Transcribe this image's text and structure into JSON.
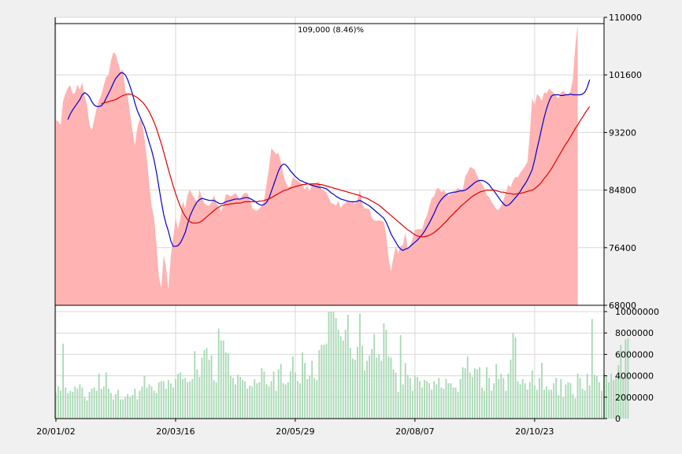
{
  "chart_data": [
    {
      "type": "area",
      "title": "",
      "annotation": "109,000 (8.46)%",
      "annotation_color": "#e00000",
      "ylim": [
        68000,
        110000
      ],
      "y_ticks": [
        68000,
        76400,
        84800,
        93200,
        101600,
        110000
      ],
      "y_tick_labels": [
        "68000",
        "76400",
        "84800",
        "93200",
        "101600",
        "110000"
      ],
      "y_axis_side": "right",
      "grid": true,
      "x_tick_labels": [
        "20/01/02",
        "20/03/16",
        "20/05/29",
        "20/08/07",
        "20/10/23"
      ],
      "x_tick_index": [
        0,
        50,
        100,
        150,
        200
      ],
      "n_days": 230,
      "colors": {
        "price_area": "#ffb3b3",
        "ma_short": "#0000d0",
        "ma_long": "#e00000",
        "volume": "#a8d8b4"
      },
      "series": [
        {
          "role": "price",
          "values": [
            95000,
            94800,
            94300,
            97800,
            98900,
            99700,
            100100,
            98800,
            99000,
            100200,
            99400,
            100500,
            98600,
            97200,
            94300,
            93500,
            95100,
            96700,
            97900,
            98700,
            100100,
            101300,
            101600,
            103700,
            104900,
            104600,
            103300,
            102100,
            102400,
            99300,
            98500,
            96000,
            93400,
            91300,
            93900,
            95200,
            94600,
            92300,
            89400,
            85700,
            82400,
            80800,
            76900,
            72200,
            70600,
            75300,
            73600,
            70300,
            75200,
            77800,
            80800,
            79100,
            80700,
            83200,
            82100,
            84100,
            84900,
            84100,
            83600,
            82800,
            84900,
            83700,
            82900,
            82600,
            82500,
            83000,
            84100,
            83000,
            82300,
            81700,
            82500,
            84200,
            84100,
            83900,
            84100,
            84400,
            83900,
            83400,
            84100,
            84400,
            84300,
            83500,
            82200,
            81900,
            81800,
            82100,
            82500,
            83300,
            85700,
            88000,
            90900,
            90500,
            90000,
            90200,
            88900,
            87100,
            85900,
            85300,
            85300,
            86700,
            86300,
            86200,
            85900,
            85600,
            84900,
            85400,
            84600,
            85600,
            85700,
            85900,
            86000,
            84900,
            84700,
            84500,
            83700,
            82900,
            82800,
            82500,
            83200,
            82200,
            82700,
            82900,
            83300,
            82900,
            83100,
            82800,
            83400,
            84900,
            82800,
            82100,
            82100,
            82000,
            80700,
            80400,
            80300,
            80400,
            80300,
            80200,
            78200,
            74800,
            73000,
            75000,
            76600,
            75600,
            76600,
            76800,
            78600,
            76200,
            76800,
            77700,
            79000,
            79100,
            79100,
            79100,
            80300,
            81100,
            82400,
            83600,
            83900,
            85000,
            85100,
            84500,
            84800,
            84400,
            84000,
            84300,
            84400,
            84800,
            85100,
            84900,
            84900,
            86800,
            87300,
            88200,
            88000,
            87800,
            86900,
            86200,
            85700,
            85100,
            84100,
            83800,
            83100,
            82600,
            82000,
            81900,
            82500,
            83400,
            84400,
            85600,
            85200,
            86200,
            86700,
            86700,
            87300,
            87800,
            88300,
            88900,
            93000,
            98200,
            97200,
            98800,
            98500,
            97800,
            99100,
            98900,
            99600,
            99300,
            99000,
            98500,
            98200,
            99000,
            99300,
            98900,
            98700,
            99200,
            101100,
            105800,
            109000
          ]
        },
        {
          "role": "ma_short",
          "values": [
            null,
            null,
            null,
            null,
            null,
            95100,
            95900,
            96500,
            97000,
            97500,
            98000,
            98700,
            99000,
            98800,
            98400,
            97700,
            97200,
            97000,
            97000,
            97100,
            97500,
            98200,
            98900,
            99600,
            100400,
            101100,
            101500,
            101900,
            101900,
            101600,
            100900,
            99900,
            98800,
            97500,
            96400,
            95600,
            94800,
            94000,
            92900,
            91700,
            90600,
            89200,
            87400,
            85300,
            83200,
            81300,
            79900,
            78800,
            77400,
            76600,
            76600,
            76700,
            77100,
            77800,
            78600,
            79800,
            81000,
            81800,
            82500,
            83100,
            83400,
            83600,
            83500,
            83400,
            83300,
            83300,
            83300,
            83100,
            82900,
            82800,
            82900,
            83100,
            83200,
            83300,
            83400,
            83500,
            83500,
            83500,
            83600,
            83700,
            83700,
            83600,
            83400,
            83200,
            82900,
            82700,
            82600,
            82700,
            83000,
            83600,
            84600,
            85600,
            86600,
            87600,
            88300,
            88600,
            88500,
            88100,
            87600,
            87200,
            86800,
            86500,
            86200,
            86100,
            85900,
            85800,
            85600,
            85500,
            85400,
            85300,
            85200,
            85200,
            85100,
            85000,
            84700,
            84400,
            84200,
            83900,
            83700,
            83500,
            83400,
            83300,
            83200,
            83100,
            83100,
            83100,
            83200,
            83300,
            83100,
            82900,
            82700,
            82500,
            82200,
            81900,
            81600,
            81300,
            81000,
            80700,
            80100,
            79300,
            78400,
            77800,
            77200,
            76600,
            76200,
            76000,
            76200,
            76300,
            76600,
            76900,
            77200,
            77500,
            77900,
            78300,
            78800,
            79400,
            80000,
            80700,
            81400,
            82200,
            82900,
            83400,
            83800,
            84100,
            84300,
            84400,
            84500,
            84500,
            84600,
            84700,
            84700,
            84800,
            85000,
            85300,
            85600,
            85900,
            86100,
            86200,
            86200,
            86100,
            85900,
            85600,
            85100,
            84700,
            84200,
            83700,
            83200,
            82800,
            82500,
            82600,
            82900,
            83300,
            83700,
            84100,
            84600,
            85200,
            85700,
            86300,
            87000,
            87800,
            89200,
            90800,
            92300,
            93900,
            95400,
            96700,
            97700,
            98500,
            98700,
            98700,
            98700,
            98600,
            98600,
            98700,
            98700,
            98800,
            98700,
            98700,
            98700,
            98700,
            98800,
            99100,
            99800,
            100900
          ]
        },
        {
          "role": "ma_long",
          "values": [
            null,
            null,
            null,
            null,
            null,
            null,
            null,
            null,
            null,
            null,
            null,
            null,
            null,
            null,
            null,
            null,
            null,
            null,
            null,
            97400,
            97500,
            97600,
            97700,
            97800,
            97900,
            98000,
            98200,
            98400,
            98600,
            98700,
            98800,
            98800,
            98700,
            98500,
            98300,
            98000,
            97700,
            97300,
            96800,
            96200,
            95500,
            94700,
            93800,
            92700,
            91600,
            90400,
            89100,
            87800,
            86600,
            85400,
            84300,
            83300,
            82400,
            81600,
            81000,
            80500,
            80200,
            80000,
            80000,
            80000,
            80100,
            80300,
            80600,
            80900,
            81200,
            81500,
            81800,
            82100,
            82300,
            82500,
            82600,
            82700,
            82700,
            82800,
            82800,
            82900,
            82900,
            82900,
            83000,
            83100,
            83100,
            83100,
            83100,
            83100,
            83100,
            83200,
            83200,
            83300,
            83400,
            83500,
            83700,
            83900,
            84100,
            84300,
            84500,
            84700,
            84800,
            84900,
            85100,
            85200,
            85300,
            85400,
            85500,
            85600,
            85600,
            85700,
            85700,
            85700,
            85700,
            85700,
            85600,
            85600,
            85500,
            85400,
            85300,
            85200,
            85100,
            85000,
            84900,
            84800,
            84700,
            84600,
            84500,
            84400,
            84300,
            84200,
            84100,
            84000,
            83800,
            83700,
            83600,
            83400,
            83200,
            83000,
            82800,
            82600,
            82300,
            82000,
            81700,
            81400,
            81100,
            80800,
            80500,
            80200,
            79900,
            79600,
            79300,
            79000,
            78800,
            78500,
            78300,
            78100,
            78000,
            78000,
            78000,
            78100,
            78200,
            78400,
            78600,
            78900,
            79200,
            79500,
            79900,
            80200,
            80600,
            81000,
            81300,
            81700,
            82000,
            82400,
            82700,
            83000,
            83300,
            83600,
            83900,
            84100,
            84300,
            84500,
            84600,
            84700,
            84800,
            84800,
            84800,
            84800,
            84700,
            84600,
            84500,
            84500,
            84400,
            84300,
            84300,
            84200,
            84200,
            84300,
            84300,
            84400,
            84500,
            84600,
            84700,
            84800,
            85000,
            85300,
            85600,
            86000,
            86500,
            86900,
            87400,
            87900,
            88500,
            89100,
            89700,
            90300,
            90900,
            91500,
            92000,
            92600,
            93200,
            93800,
            94300,
            94900,
            95400,
            96000,
            96500,
            97000
          ]
        }
      ]
    },
    {
      "type": "bar",
      "title": "",
      "ylim": [
        0,
        10000000
      ],
      "y_ticks": [
        0,
        2000000,
        4000000,
        6000000,
        8000000,
        10000000
      ],
      "y_tick_labels": [
        "0",
        "2000000",
        "4000000",
        "6000000",
        "8000000",
        "10000000"
      ],
      "y_axis_side": "right",
      "grid": true,
      "series": [
        {
          "role": "volume",
          "values": [
            2400000,
            3000000,
            2600000,
            7000000,
            2900000,
            2400000,
            2600000,
            2500000,
            3000000,
            2800000,
            3200000,
            2900000,
            2000000,
            1700000,
            2500000,
            2800000,
            2900000,
            2600000,
            4200000,
            2800000,
            3000000,
            4300000,
            2800000,
            2400000,
            1800000,
            2300000,
            2700000,
            1800000,
            1800000,
            2000000,
            2300000,
            2000000,
            2200000,
            2800000,
            1800000,
            2600000,
            3000000,
            4000000,
            2900000,
            3200000,
            3000000,
            2600000,
            2400000,
            3400000,
            3500000,
            3500000,
            2800000,
            3600000,
            3300000,
            2900000,
            3700000,
            4200000,
            4300000,
            3700000,
            3800000,
            3400000,
            3500000,
            3700000,
            6300000,
            4600000,
            3900000,
            5700000,
            6400000,
            6600000,
            5500000,
            5900000,
            3600000,
            3400000,
            8400000,
            7300000,
            7300000,
            6200000,
            6100000,
            4000000,
            3800000,
            3200000,
            4100000,
            3900000,
            3600000,
            3500000,
            2800000,
            3100000,
            3000000,
            3700000,
            3300000,
            3400000,
            4700000,
            4400000,
            3200000,
            3000000,
            3500000,
            4400000,
            2600000,
            4600000,
            5100000,
            3300000,
            3200000,
            3400000,
            4400000,
            5800000,
            4300000,
            3500000,
            3300000,
            6200000,
            5200000,
            3700000,
            4000000,
            5400000,
            3800000,
            3600000,
            6400000,
            6900000,
            6900000,
            7000000,
            10900000,
            11500000,
            10500000,
            9400000,
            8300000,
            7700000,
            7300000,
            8300000,
            9700000,
            6600000,
            5600000,
            5500000,
            6700000,
            9800000,
            6800000,
            4500000,
            5400000,
            5900000,
            6500000,
            7900000,
            5700000,
            6000000,
            5400000,
            8900000,
            8300000,
            5800000,
            5700000,
            4600000,
            4300000,
            2500000,
            7800000,
            3200000,
            5200000,
            4100000,
            3800000,
            2600000,
            4000000,
            3900000,
            3500000,
            2900000,
            3600000,
            3500000,
            3300000,
            2700000,
            3500000,
            3200000,
            3800000,
            2900000,
            2800000,
            3700000,
            3300000,
            3300000,
            2900000,
            2900000,
            2500000,
            3700000,
            4800000,
            4700000,
            5800000,
            4300000,
            3900000,
            4700000,
            4600000,
            4800000,
            2900000,
            2600000,
            4800000,
            3800000,
            2600000,
            3300000,
            5100000,
            3700000,
            4200000,
            3800000,
            2600000,
            4200000,
            5500000,
            8000000,
            7600000,
            3500000,
            3200000,
            3700000,
            3300000,
            2700000,
            3400000,
            4500000,
            3100000,
            2700000,
            3800000,
            5200000,
            2700000,
            3000000,
            2700000,
            2700000,
            3300000,
            3800000,
            2200000,
            3700000,
            2000000,
            3200000,
            3400000,
            3300000,
            2300000,
            1900000,
            4200000,
            3800000,
            2800000,
            2600000,
            4200000,
            3100000,
            9300000,
            4100000,
            4000000,
            3400000,
            2600000,
            4200000,
            4000000,
            3400000,
            4200000,
            3600000,
            4000000,
            5000000,
            6900000,
            3900000,
            7400000,
            7500000
          ]
        }
      ]
    }
  ]
}
